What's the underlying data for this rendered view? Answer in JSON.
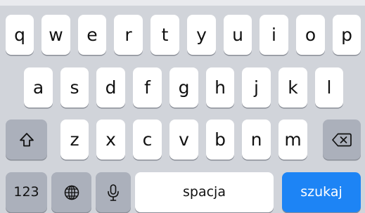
{
  "keyboard": {
    "rows": [
      [
        "q",
        "w",
        "e",
        "r",
        "t",
        "y",
        "u",
        "i",
        "o",
        "p"
      ],
      [
        "a",
        "s",
        "d",
        "f",
        "g",
        "h",
        "j",
        "k",
        "l"
      ],
      [
        "z",
        "x",
        "c",
        "v",
        "b",
        "n",
        "m"
      ]
    ],
    "numbers_label": "123",
    "space_label": "spacja",
    "return_label": "szukaj",
    "icons": [
      "shift-icon",
      "backspace-icon",
      "globe-icon",
      "microphone-icon"
    ],
    "colors": {
      "background": "#d1d4da",
      "letter_key": "#ffffff",
      "function_key": "#abb0bb",
      "accent": "#1d84f5"
    }
  }
}
